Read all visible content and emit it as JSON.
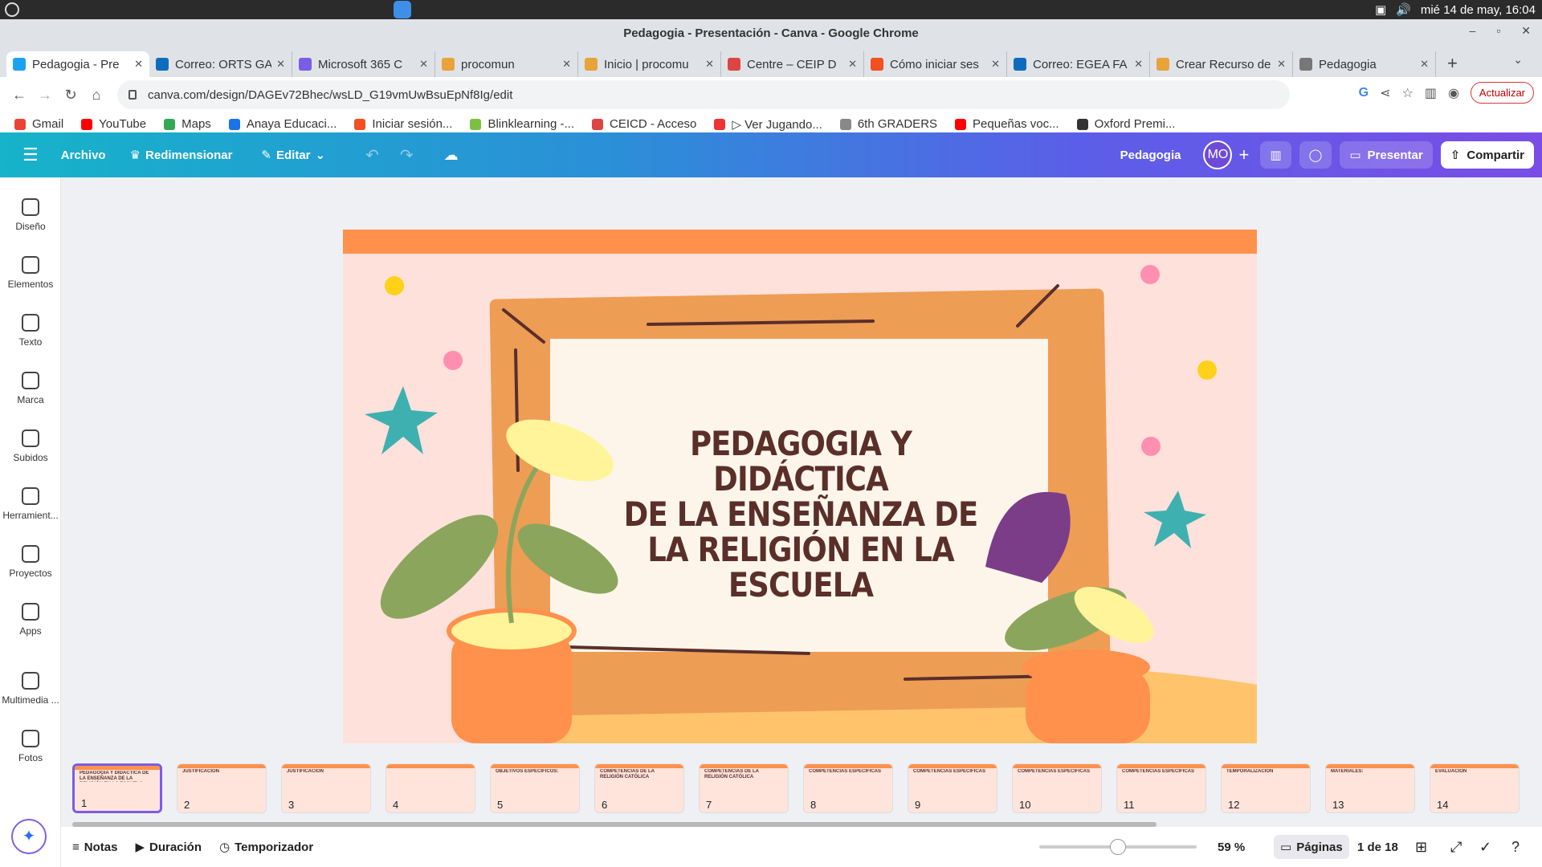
{
  "os": {
    "datetime": "mié 14 de may, 16:04"
  },
  "window": {
    "title": "Pedagogia - Presentación - Canva - Google Chrome"
  },
  "tabs": [
    {
      "title": "Pedagogia - Pre",
      "color": "#1da1f2",
      "active": true
    },
    {
      "title": "Correo: ORTS GA",
      "color": "#0f6cbd"
    },
    {
      "title": "Microsoft 365 C",
      "color": "#7b5ce6"
    },
    {
      "title": "procomun",
      "color": "#e8a33b"
    },
    {
      "title": "Inicio | procomu",
      "color": "#e8a33b"
    },
    {
      "title": "Centre – CEIP D",
      "color": "#d44"
    },
    {
      "title": "Cómo iniciar ses",
      "color": "#f25022"
    },
    {
      "title": "Correo: EGEA FA",
      "color": "#0f6cbd"
    },
    {
      "title": "Crear Recurso de",
      "color": "#e8a33b"
    },
    {
      "title": "Pedagogia",
      "color": "#777"
    }
  ],
  "url": "canva.com/design/DAGEv72Bhec/wsLD_G19vmUwBsuEpNf8Ig/edit",
  "update_label": "Actualizar",
  "bookmarks": [
    {
      "label": "Gmail",
      "color": "#ea4335"
    },
    {
      "label": "YouTube",
      "color": "#ff0000"
    },
    {
      "label": "Maps",
      "color": "#34a853"
    },
    {
      "label": "Anaya Educaci...",
      "color": "#1a73e8"
    },
    {
      "label": "Iniciar sesión...",
      "color": "#f25022"
    },
    {
      "label": "Blinklearning -...",
      "color": "#7ac143"
    },
    {
      "label": "CEICD - Acceso",
      "color": "#d44"
    },
    {
      "label": "▷ Ver Jugando...",
      "color": "#e33"
    },
    {
      "label": "6th GRADERS",
      "color": "#888"
    },
    {
      "label": "Pequeñas voc...",
      "color": "#ff0000"
    },
    {
      "label": "Oxford Premi...",
      "color": "#333"
    }
  ],
  "canva": {
    "archivo": "Archivo",
    "redimensionar": "Redimensionar",
    "editar": "Editar",
    "doc_title": "Pedagogia",
    "avatar": "MO",
    "presentar": "Presentar",
    "compartir": "Compartir"
  },
  "sidebar": [
    "Diseño",
    "Elementos",
    "Texto",
    "Marca",
    "Subidos",
    "Herramient...",
    "Proyectos",
    "Apps",
    "Multimedia ...",
    "Fotos"
  ],
  "slide": {
    "title_lines": [
      "PEDAGOGIA Y DIDÁCTICA",
      "DE LA ENSEÑANZA DE",
      "LA RELIGIÓN EN LA",
      "ESCUELA"
    ]
  },
  "thumbnails": [
    {
      "num": "1",
      "text": "PEDAGOGIA Y DIDÁCTICA DE LA ENSEÑANZA DE LA RELIGIÓN EN LA ESCUELA"
    },
    {
      "num": "2",
      "text": "JUSTIFICACIÓN"
    },
    {
      "num": "3",
      "text": "JUSTIFICACIÓN"
    },
    {
      "num": "4",
      "text": ""
    },
    {
      "num": "5",
      "text": "OBJETIVOS ESPECÍFICOS:"
    },
    {
      "num": "6",
      "text": "COMPETENCIAS DE LA RELIGIÓN CATÓLICA"
    },
    {
      "num": "7",
      "text": "COMPETENCIAS DE LA RELIGIÓN CATÓLICA"
    },
    {
      "num": "8",
      "text": "COMPETENCIAS ESPECÍFICAS"
    },
    {
      "num": "9",
      "text": "COMPETENCIAS ESPECÍFICAS"
    },
    {
      "num": "10",
      "text": "COMPETENCIAS ESPECÍFICAS"
    },
    {
      "num": "11",
      "text": "COMPETENCIAS ESPECÍFICAS"
    },
    {
      "num": "12",
      "text": "TEMPORALIZACIÓN"
    },
    {
      "num": "13",
      "text": "MATERIALES:"
    },
    {
      "num": "14",
      "text": "EVALUACIÓN"
    }
  ],
  "bottom": {
    "notas": "Notas",
    "duracion": "Duración",
    "temporizador": "Temporizador",
    "zoom": "59 %",
    "zoom_level": 0.59,
    "paginas": "Páginas",
    "page_count": "1 de 18"
  }
}
